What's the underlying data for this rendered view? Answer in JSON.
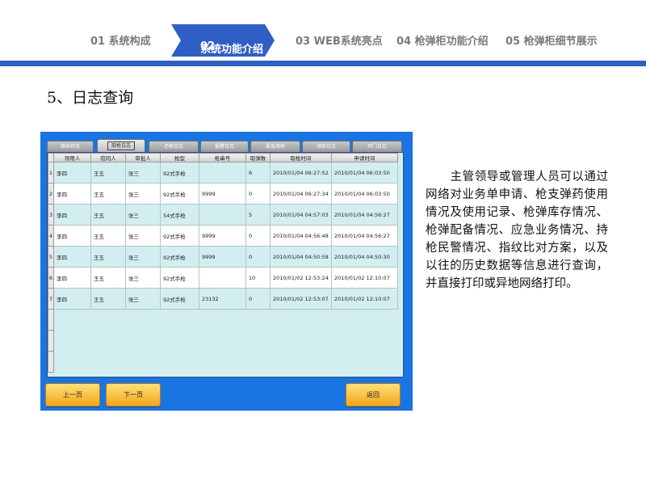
{
  "nav": {
    "items": [
      {
        "num": "01",
        "label": "系统构成"
      },
      {
        "num": "02",
        "label": "系统功能介绍"
      },
      {
        "num": "03",
        "label": "WEB系统亮点"
      },
      {
        "num": "04",
        "label": "枪弹柜功能介绍"
      },
      {
        "num": "05",
        "label": "枪弹柜细节展示"
      }
    ],
    "active_index": 1,
    "accent_color": "#2f5fc4"
  },
  "section_title": "5、日志查询",
  "app": {
    "tabs": [
      "箱体状态",
      "取枪日志",
      "还枪日志",
      "报警日志",
      "紧急用枪",
      "领放日志",
      "开门日志"
    ],
    "active_tab": 1,
    "columns": [
      "领用人",
      "陪同人",
      "审批人",
      "枪型",
      "枪串号",
      "取弹数",
      "取枪时间",
      "申请时间"
    ],
    "rows": [
      {
        "n": "1",
        "c": [
          "李四",
          "王五",
          "张三",
          "92式手枪",
          "",
          "6",
          "2010/01/04 06:27:52",
          "2010/01/04 06:03:50"
        ]
      },
      {
        "n": "2",
        "c": [
          "李四",
          "王五",
          "张三",
          "92式手枪",
          "9999",
          "0",
          "2010/01/04 06:27:34",
          "2010/01/04 06:03:50"
        ]
      },
      {
        "n": "3",
        "c": [
          "李四",
          "王五",
          "张三",
          "54式手枪",
          "",
          "5",
          "2010/01/04 04:57:03",
          "2010/01/04 04:56:27"
        ]
      },
      {
        "n": "4",
        "c": [
          "李四",
          "王五",
          "张三",
          "92式手枪",
          "9999",
          "0",
          "2010/01/04 04:56:48",
          "2010/01/04 04:56:27"
        ]
      },
      {
        "n": "5",
        "c": [
          "李四",
          "王五",
          "张三",
          "92式手枪",
          "9999",
          "0",
          "2010/01/04 04:50:58",
          "2010/01/04 04:50:30"
        ]
      },
      {
        "n": "6",
        "c": [
          "李四",
          "王五",
          "张三",
          "92式手枪",
          "",
          "10",
          "2010/01/02 12:53:24",
          "2010/01/02 12:10:07"
        ]
      },
      {
        "n": "7",
        "c": [
          "李四",
          "王五",
          "张三",
          "92式手枪",
          "23132",
          "0",
          "2010/01/02 12:53:07",
          "2010/01/02 12:10:07"
        ]
      }
    ],
    "buttons": {
      "prev": "上一页",
      "next": "下一页",
      "back": "返回"
    }
  },
  "description": "主管领导或管理人员可以通过网络对业务单申请、枪支弹药使用情况及使用记录、枪弹库存情况、枪弹配备情况、应急业务情况、持枪民警情况、指纹比对方案，以及以往的历史数据等信息进行查询，并直接打印或异地网络打印。"
}
